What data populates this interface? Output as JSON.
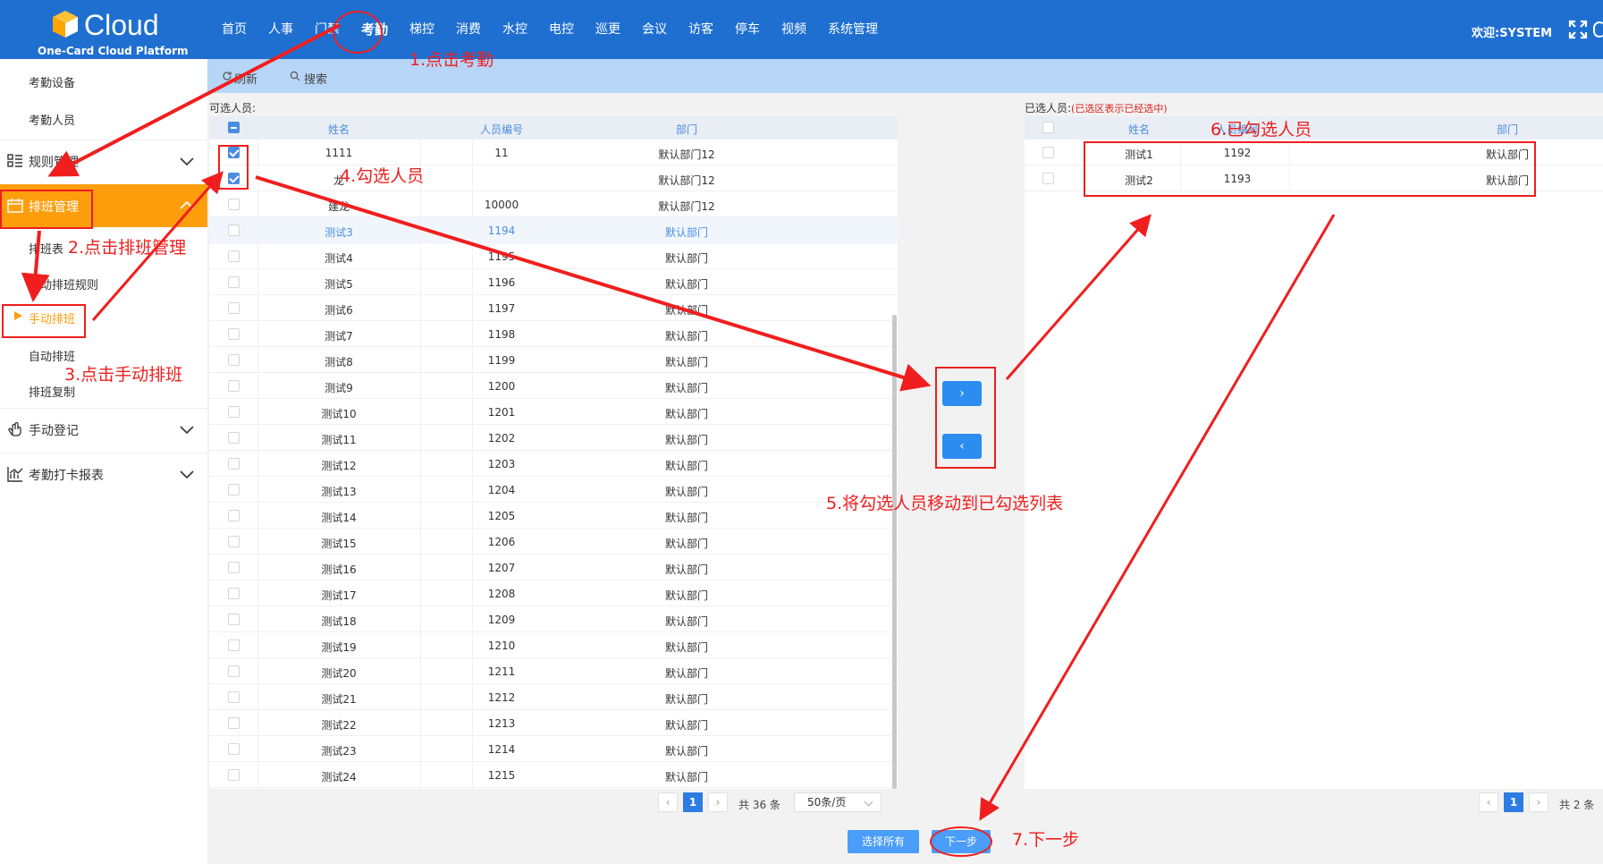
{
  "header": {
    "logo_text": "Cloud",
    "logo_sub": "One-Card Cloud Platform",
    "nav": [
      "首页",
      "人事",
      "门禁",
      "考勤",
      "梯控",
      "消费",
      "水控",
      "电控",
      "巡更",
      "会议",
      "访客",
      "停车",
      "视频",
      "系统管理"
    ],
    "active_nav": "考勤",
    "welcome": "欢迎:SYSTEM"
  },
  "sidebar": {
    "top_items": [
      "考勤设备",
      "考勤人员"
    ],
    "groups": {
      "rules": "规则管理",
      "schedule": "排班管理",
      "manual_reg": "手动登记",
      "report": "考勤打卡报表"
    },
    "schedule_items": [
      "排班表",
      "自动排班规则",
      "手动排班",
      "自动排班",
      "排班复制"
    ],
    "current": "手动排班"
  },
  "toolbar": {
    "refresh": "刷新",
    "search": "搜索"
  },
  "left_panel": {
    "caption": "可选人员:",
    "headers": [
      "姓名",
      "人员编号",
      "部门"
    ],
    "rows": [
      {
        "name": "1111",
        "id": "11",
        "dept": "默认部门12",
        "checked": true
      },
      {
        "name": "龙",
        "id": "",
        "dept": "默认部门12",
        "checked": true
      },
      {
        "name": "建龙",
        "id": "10000",
        "dept": "默认部门12",
        "checked": false
      },
      {
        "name": "测试3",
        "id": "1194",
        "dept": "默认部门",
        "checked": false
      },
      {
        "name": "测试4",
        "id": "1195",
        "dept": "默认部门",
        "checked": false
      },
      {
        "name": "测试5",
        "id": "1196",
        "dept": "默认部门",
        "checked": false
      },
      {
        "name": "测试6",
        "id": "1197",
        "dept": "默认部门",
        "checked": false
      },
      {
        "name": "测试7",
        "id": "1198",
        "dept": "默认部门",
        "checked": false
      },
      {
        "name": "测试8",
        "id": "1199",
        "dept": "默认部门",
        "checked": false
      },
      {
        "name": "测试9",
        "id": "1200",
        "dept": "默认部门",
        "checked": false
      },
      {
        "name": "测试10",
        "id": "1201",
        "dept": "默认部门",
        "checked": false
      },
      {
        "name": "测试11",
        "id": "1202",
        "dept": "默认部门",
        "checked": false
      },
      {
        "name": "测试12",
        "id": "1203",
        "dept": "默认部门",
        "checked": false
      },
      {
        "name": "测试13",
        "id": "1204",
        "dept": "默认部门",
        "checked": false
      },
      {
        "name": "测试14",
        "id": "1205",
        "dept": "默认部门",
        "checked": false
      },
      {
        "name": "测试15",
        "id": "1206",
        "dept": "默认部门",
        "checked": false
      },
      {
        "name": "测试16",
        "id": "1207",
        "dept": "默认部门",
        "checked": false
      },
      {
        "name": "测试17",
        "id": "1208",
        "dept": "默认部门",
        "checked": false
      },
      {
        "name": "测试18",
        "id": "1209",
        "dept": "默认部门",
        "checked": false
      },
      {
        "name": "测试19",
        "id": "1210",
        "dept": "默认部门",
        "checked": false
      },
      {
        "name": "测试20",
        "id": "1211",
        "dept": "默认部门",
        "checked": false
      },
      {
        "name": "测试21",
        "id": "1212",
        "dept": "默认部门",
        "checked": false
      },
      {
        "name": "测试22",
        "id": "1213",
        "dept": "默认部门",
        "checked": false
      },
      {
        "name": "测试23",
        "id": "1214",
        "dept": "默认部门",
        "checked": false
      },
      {
        "name": "测试24",
        "id": "1215",
        "dept": "默认部门",
        "checked": false
      }
    ],
    "pager": {
      "page": "1",
      "total": "共 36 条",
      "size": "50条/页"
    }
  },
  "right_panel": {
    "caption": "已选人员:",
    "hint": "(已选区表示已经选中)",
    "headers": [
      "姓名",
      "人员编号",
      "部门"
    ],
    "rows": [
      {
        "name": "测试1",
        "id": "1192",
        "dept": "默认部门"
      },
      {
        "name": "测试2",
        "id": "1193",
        "dept": "默认部门"
      }
    ],
    "pager": {
      "page": "1",
      "total": "共 2 条"
    }
  },
  "move": {
    "right": "›",
    "left": "‹"
  },
  "buttons": {
    "select_all": "选择所有",
    "next": "下一步"
  },
  "annotations": {
    "a1": "1.点击考勤",
    "a2": "2.点击排班管理",
    "a3": "3.点击手动排班",
    "a4": "4.勾选人员",
    "a5": "5.将勾选人员移动到已勾选列表",
    "a6": "6.已勾选人员",
    "a7": "7.下一步"
  },
  "colors": {
    "header": "#1f6fd1",
    "accent": "#ff9e0d",
    "annotation": "#f01e1e",
    "primary": "#2d8cf0"
  }
}
